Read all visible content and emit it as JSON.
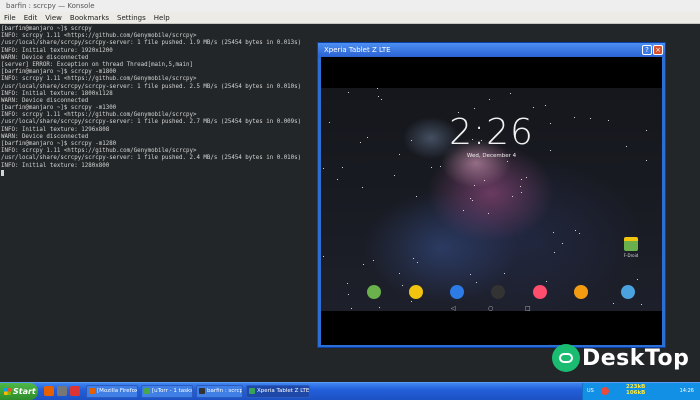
{
  "konsole": {
    "title": "barfin : scrcpy — Konsole",
    "menu": [
      "File",
      "Edit",
      "View",
      "Bookmarks",
      "Settings",
      "Help"
    ]
  },
  "terminal": {
    "lines": [
      "[barfin@manjaro ~]$ scrcpy",
      "INFO: scrcpy 1.11 <https://github.com/Genymobile/scrcpy>",
      "/usr/local/share/scrcpy/scrcpy-server: 1 file pushed. 1.9 MB/s (25454 bytes in 0.013s)",
      "INFO: Initial texture: 1920x1200",
      "WARN: Device disconnected",
      "[server] ERROR: Exception on thread Thread[main,5,main]",
      "[barfin@manjaro ~]$ scrcpy -m1800",
      "INFO: scrcpy 1.11 <https://github.com/Genymobile/scrcpy>",
      "/usr/local/share/scrcpy/scrcpy-server: 1 file pushed. 2.5 MB/s (25454 bytes in 0.010s)",
      "INFO: Initial texture: 1800x1128",
      "WARN: Device disconnected",
      "[barfin@manjaro ~]$ scrcpy -m1300",
      "INFO: scrcpy 1.11 <https://github.com/Genymobile/scrcpy>",
      "/usr/local/share/scrcpy/scrcpy-server: 1 file pushed. 2.7 MB/s (25454 bytes in 0.009s)",
      "INFO: Initial texture: 1296x808",
      "WARN: Device disconnected",
      "[barfin@manjaro ~]$ scrcpy -m1280",
      "INFO: scrcpy 1.11 <https://github.com/Genymobile/scrcpy>",
      "/usr/local/share/scrcpy/scrcpy-server: 1 file pushed. 2.4 MB/s (25454 bytes in 0.010s)",
      "INFO: Initial texture: 1280x800"
    ]
  },
  "scrcpy_window": {
    "title": "Xperia Tablet Z LTE",
    "buttons": {
      "help": "?",
      "close": "×"
    }
  },
  "device": {
    "status_left": "",
    "status_mid": "",
    "status_right": "",
    "clock": "2:26",
    "date": "Wed, December 4",
    "widget_label": "F-Droid",
    "dock_icons": [
      {
        "name": "hangouts-icon",
        "color": "#6ab04c"
      },
      {
        "name": "chrome-icon",
        "color": "#f1c40f"
      },
      {
        "name": "maps-icon",
        "color": "#2d7be5"
      },
      {
        "name": "app-drawer-icon",
        "color": "#333333"
      },
      {
        "name": "music-icon",
        "color": "#ff4d6d"
      },
      {
        "name": "photos-icon",
        "color": "#f39c12"
      },
      {
        "name": "web-icon",
        "color": "#4aa3df"
      }
    ],
    "nav": [
      "◁",
      "○",
      "□"
    ]
  },
  "taskbar": {
    "start_label": "Start",
    "tasks": [
      {
        "label": "[Mozilla Firefox]",
        "icon_color": "#e66000",
        "active": false
      },
      {
        "label": "[uTorr - 1 tasks]",
        "icon_color": "#4aa64a",
        "active": false
      },
      {
        "label": "barfin : scrcpy",
        "icon_color": "#333333",
        "active": false
      },
      {
        "label": "Xperia Tablet Z LTE",
        "icon_color": "#3aa35b",
        "active": true
      }
    ],
    "tray_lang": "US",
    "net_up": "223kB",
    "net_down": "106kB",
    "time": "14:26"
  },
  "watermark": {
    "text": "DeskTop"
  }
}
